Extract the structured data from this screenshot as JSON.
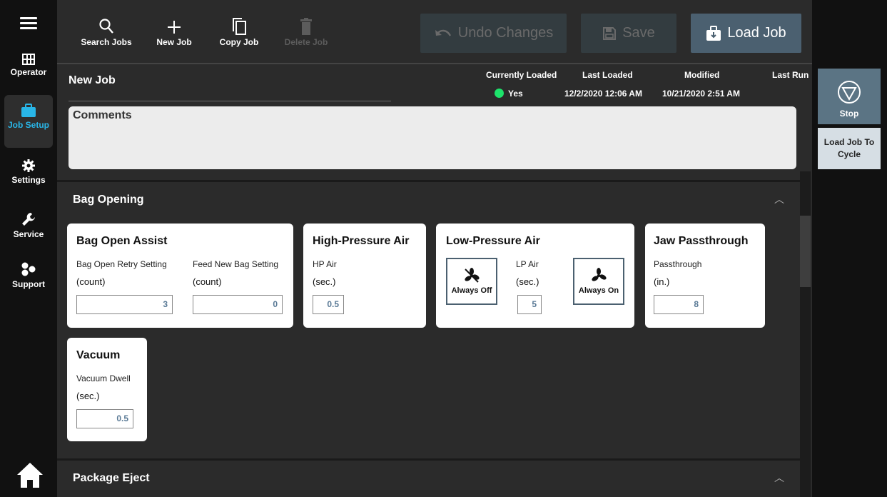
{
  "nav": {
    "items": [
      {
        "label": "Operator",
        "icon": "grid-icon"
      },
      {
        "label": "Job Setup",
        "icon": "briefcase-icon"
      },
      {
        "label": "Settings",
        "icon": "gear-icon"
      },
      {
        "label": "Service",
        "icon": "wrench-icon"
      },
      {
        "label": "Support",
        "icon": "support-icon"
      }
    ]
  },
  "toolbar": {
    "search_label": "Search Jobs",
    "new_label": "New Job",
    "copy_label": "Copy Job",
    "delete_label": "Delete Job",
    "undo_label": "Undo Changes",
    "save_label": "Save",
    "load_label": "Load Job"
  },
  "job": {
    "title": "New Job",
    "currently_loaded_header": "Currently Loaded",
    "currently_loaded_value": "Yes",
    "last_loaded_header": "Last Loaded",
    "last_loaded_value": "12/2/2020 12:06 AM",
    "modified_header": "Modified",
    "modified_value": "10/21/2020 2:51 AM",
    "last_run_header": "Last Run",
    "comments_label": "Comments"
  },
  "sections": {
    "bag_opening": "Bag Opening",
    "package_eject": "Package Eject"
  },
  "cards": {
    "bag_open_assist": {
      "title": "Bag Open Assist",
      "retry_label": "Bag Open Retry Setting",
      "retry_unit": "(count)",
      "retry_value": "3",
      "feed_label": "Feed New Bag Setting",
      "feed_unit": "(count)",
      "feed_value": "0"
    },
    "hp_air": {
      "title": "High-Pressure Air",
      "label": "HP Air",
      "unit": "(sec.)",
      "value": "0.5"
    },
    "lp_air": {
      "title": "Low-Pressure Air",
      "label": "LP Air",
      "unit": "(sec.)",
      "value": "5",
      "always_off": "Always Off",
      "always_on": "Always On"
    },
    "jaw": {
      "title": "Jaw Passthrough",
      "label": "Passthrough",
      "unit": "(in.)",
      "value": "8"
    },
    "vacuum": {
      "title": "Vacuum",
      "label": "Vacuum Dwell",
      "unit": "(sec.)",
      "value": "0.5"
    }
  },
  "right": {
    "stop_label": "Stop",
    "load_cycle_label": "Load Job To Cycle"
  },
  "colors": {
    "accent": "#29b6e8",
    "status_green": "#1de36b",
    "primary_button": "#4b6070"
  }
}
